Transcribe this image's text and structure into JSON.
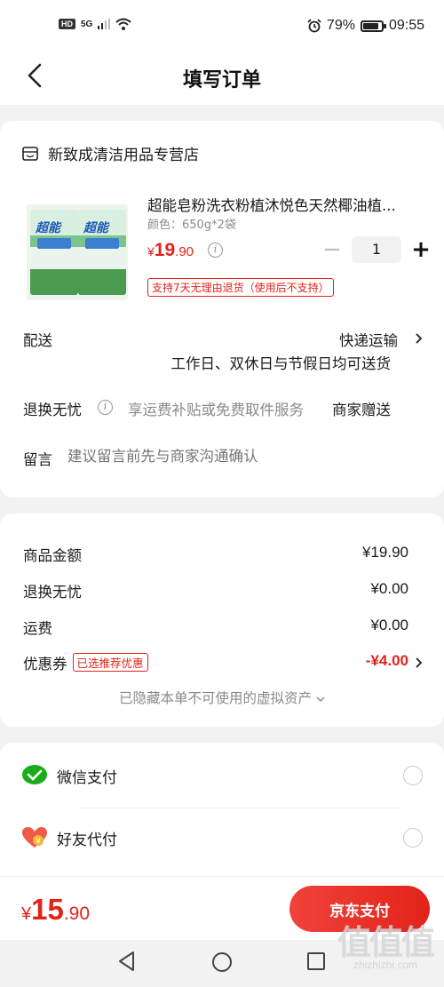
{
  "status_bar": {
    "hd": "HD",
    "network": "5G",
    "battery": "79%",
    "battery_level": 0.79,
    "time": "09:55"
  },
  "header": {
    "title": "填写订单"
  },
  "shop": {
    "name": "新致成清洁用品专营店"
  },
  "product": {
    "name": "超能皂粉洗衣粉植沐悦色天然椰油植...",
    "spec": "颜色：650g*2袋",
    "price_currency": "¥",
    "price_int": "19",
    "price_dec": ".90",
    "quantity": "1",
    "qty_minus": "−",
    "qty_plus": "+",
    "return_tag": "支持7天无理由退货（使用后不支持）",
    "image_brand": "超能"
  },
  "delivery": {
    "label": "配送",
    "method": "快递运输",
    "note": "工作日、双休日与节假日均可送货"
  },
  "return_service": {
    "label": "退换无忧",
    "desc": "享运费补贴或免费取件服务",
    "gift": "商家赠送"
  },
  "message": {
    "label": "留言",
    "placeholder": "建议留言前先与商家沟通确认"
  },
  "fees": {
    "goods_label": "商品金额",
    "goods_value": "¥19.90",
    "return_label": "退换无忧",
    "return_value": "¥0.00",
    "shipping_label": "运费",
    "shipping_value": "¥0.00",
    "coupon_label": "优惠券",
    "coupon_tag": "已选推荐优惠",
    "coupon_value": "-¥4.00",
    "hidden_assets": "已隐藏本单不可使用的虚拟资产"
  },
  "payment": {
    "wechat": "微信支付",
    "friend": "好友代付"
  },
  "bottom": {
    "total_currency": "¥",
    "total_int": "15",
    "total_dec": ".90",
    "pay_button": "京东支付"
  },
  "watermark": {
    "big": "值值值",
    "small": "zhizhizhi.com"
  },
  "colors": {
    "accent": "#e2231a",
    "wechat": "#1aad19"
  }
}
